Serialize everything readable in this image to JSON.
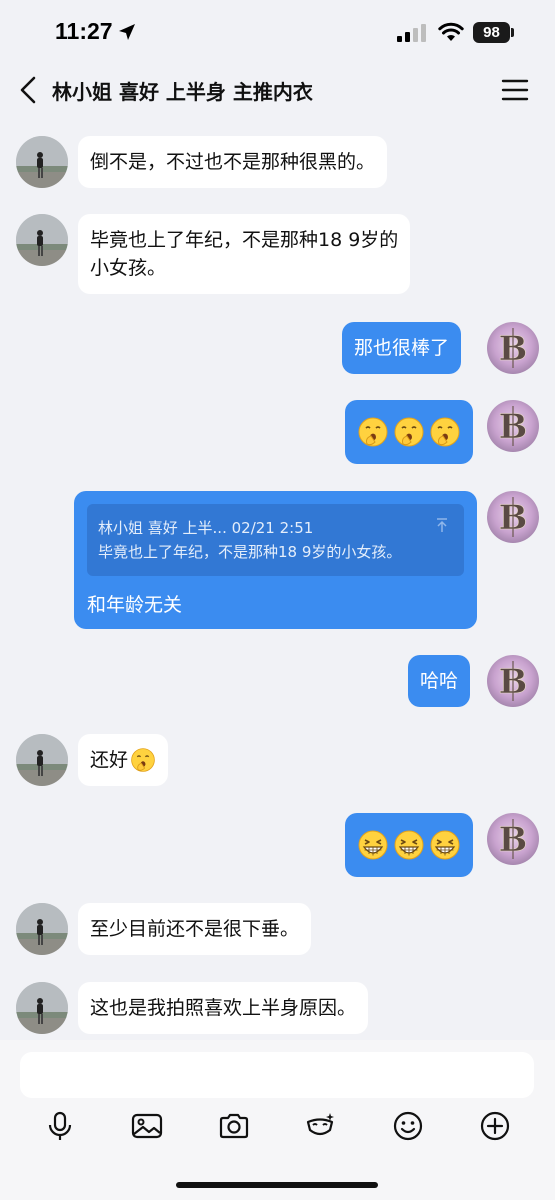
{
  "status_bar": {
    "time": "11:27",
    "battery": "98"
  },
  "nav": {
    "title": "林小姐 喜好 上半身 主推内衣"
  },
  "messages": [
    {
      "from": "contact",
      "text": "倒不是，不过也不是那种很黑的。"
    },
    {
      "from": "contact",
      "lines": [
        "毕竟也上了年纪，不是那种18 9岁的",
        "小女孩。"
      ]
    },
    {
      "from": "me",
      "text": "那也很棒了"
    },
    {
      "from": "me",
      "emoji": [
        "yawn-emoji",
        "yawn-emoji",
        "yawn-emoji"
      ]
    },
    {
      "from": "me",
      "quote": {
        "meta": "林小姐 喜好 上半... 02/21 2:51",
        "text": "毕竟也上了年纪，不是那种18 9岁的小女孩。"
      },
      "text": "和年龄无关"
    },
    {
      "from": "me",
      "text": "哈哈"
    },
    {
      "from": "contact",
      "text": "还好",
      "emoji": [
        "yawn-emoji"
      ]
    },
    {
      "from": "me",
      "emoji": [
        "grin-emoji",
        "grin-emoji",
        "grin-emoji"
      ]
    },
    {
      "from": "contact",
      "text": "至少目前还不是很下垂。"
    },
    {
      "from": "contact",
      "text": "这也是我拍照喜欢上半身原因。"
    }
  ],
  "input": {
    "placeholder": ""
  },
  "toolbar": [
    "microphone-icon",
    "image-icon",
    "camera-icon",
    "magic-mask-icon",
    "smiley-icon",
    "plus-icon"
  ],
  "colors": {
    "background": "#f1f2f6",
    "outgoing_bubble": "#3b8cf0",
    "incoming_bubble": "#ffffff",
    "quote_box": "#3278d4"
  }
}
